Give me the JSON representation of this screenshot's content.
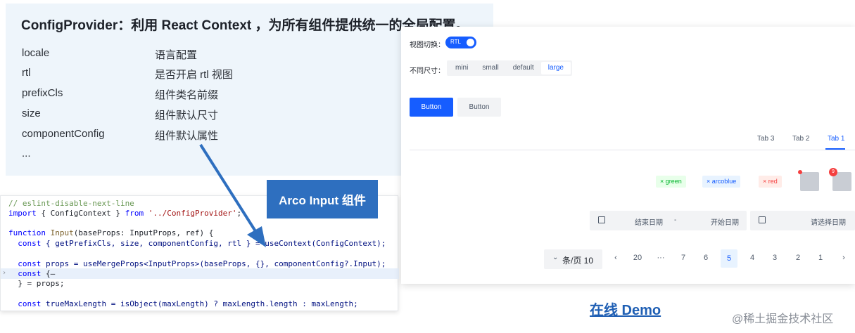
{
  "info": {
    "title": "ConfigProvider：利用 React Context ，为所有组件提供统一的全局配置。",
    "props": [
      {
        "name": "locale",
        "desc": "语言配置"
      },
      {
        "name": "rtl",
        "desc": "是否开启 rtl 视图"
      },
      {
        "name": "prefixCls",
        "desc": "组件类名前缀"
      },
      {
        "name": "size",
        "desc": "组件默认尺寸"
      },
      {
        "name": "componentConfig",
        "desc": "组件默认属性"
      },
      {
        "name": "...",
        "desc": ""
      }
    ]
  },
  "code": {
    "label": "Arco Input 组件",
    "marker": "›",
    "lines": {
      "l1": "// eslint-disable-next-line",
      "l2_kw": "import",
      "l2_mid": " { ConfigContext } ",
      "l2_from": "from",
      "l2_str": " '../ConfigProvider'",
      "l2_end": ";",
      "l3_kw": "function",
      "l3_fn": " Input",
      "l3_rest": "(baseProps: InputProps, ref) {",
      "l4_kw": "  const",
      "l4_rest": " { getPrefixCls, size, componentConfig, rtl } = useContext(ConfigContext);",
      "l5_kw": "  const",
      "l5_rest": " props = useMergeProps<InputProps>(baseProps, {}, componentConfig?.Input);",
      "l6_kw": "  const",
      "l6_rest": " {–",
      "l7": "  } = props;",
      "l8_kw": "  const",
      "l8_rest": " trueMaxLength = isObject(maxLength) ? maxLength.length : maxLength;"
    }
  },
  "demo": {
    "view_switch_label": "视图切换：",
    "rtl_switch_text": "RTL",
    "size_label": "不同尺寸：",
    "sizes": [
      "mini",
      "small",
      "default",
      "large"
    ],
    "active_size": "large",
    "button_primary": "Button",
    "button_secondary": "Button",
    "tabs": [
      "Tab 3",
      "Tab 2",
      "Tab 1"
    ],
    "active_tab": "Tab 1",
    "tags": [
      {
        "label": "× green"
      },
      {
        "label": "× arcoblue"
      },
      {
        "label": "× red"
      }
    ],
    "badge_count": "9",
    "range_picker": {
      "end": "结束日期",
      "start": "开始日期",
      "separator": "-"
    },
    "date_picker_placeholder": "请选择日期",
    "page_size": "条/页 10",
    "page_size_chevron": "⌄",
    "pager": {
      "prev": "‹",
      "items": [
        "20",
        "···",
        "7",
        "6",
        "5",
        "4",
        "3",
        "2",
        "1"
      ],
      "next": "›",
      "active": "5"
    }
  },
  "footer": {
    "demo_link": "在线 Demo",
    "watermark": "@稀土掘金技术社区"
  },
  "colors": {
    "primary": "#165dff",
    "arrow": "#2e6fbf",
    "panel_bg": "#eef5fb"
  }
}
